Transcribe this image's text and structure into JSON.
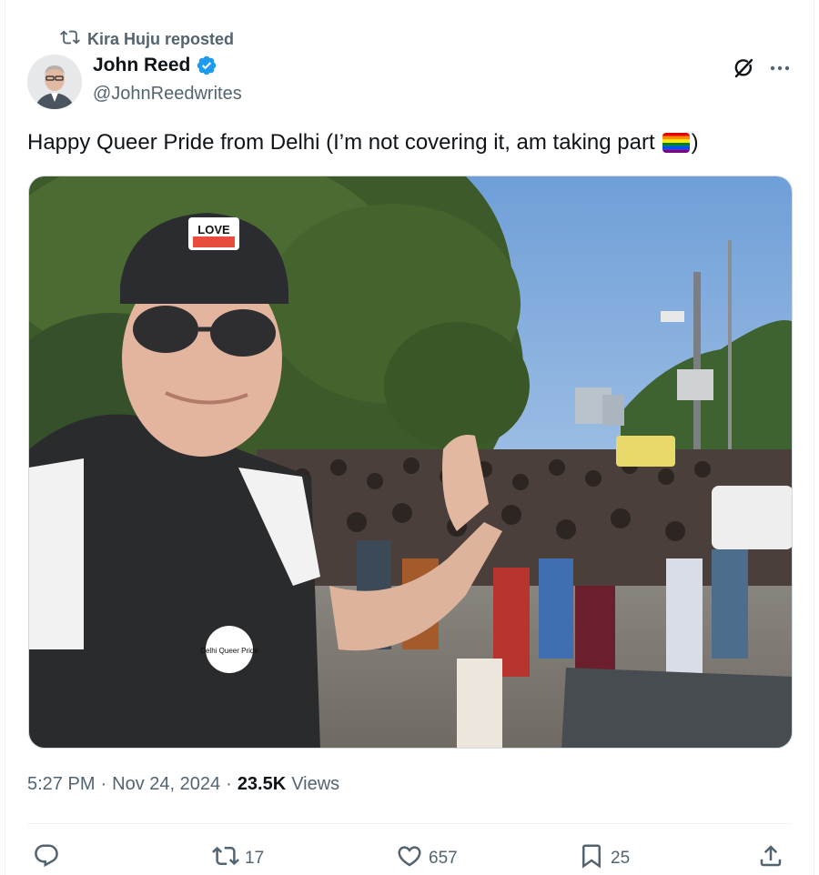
{
  "repost": {
    "label": "Kira Huju reposted"
  },
  "author": {
    "name": "John Reed",
    "handle": "@JohnReedwrites",
    "verified": true
  },
  "tweet": {
    "text": "Happy Queer Pride from Delhi (I’m not covering it,  am taking part",
    "text_suffix": ")",
    "emoji": "rainbow-flag"
  },
  "meta": {
    "time": "5:27 PM",
    "date": "Nov 24, 2024",
    "separator": "·",
    "views_count": "23.5K",
    "views_label": "Views"
  },
  "actions": {
    "reply_count": "",
    "retweet_count": "17",
    "like_count": "657",
    "bookmark_count": "25"
  },
  "media": {
    "cap_badge": "LOVE",
    "pin_text": "Delhi Queer Pride"
  },
  "icons": {
    "repost": "repost-icon",
    "verified": "verified-badge-icon",
    "grok": "grok-icon",
    "more": "more-options-icon",
    "reply": "reply-icon",
    "retweet": "retweet-icon",
    "like": "like-icon",
    "bookmark": "bookmark-icon",
    "share": "share-icon"
  },
  "colors": {
    "text_primary": "#0f1419",
    "text_secondary": "#536471",
    "verified_blue": "#1d9bf0",
    "divider": "#eff3f4"
  }
}
